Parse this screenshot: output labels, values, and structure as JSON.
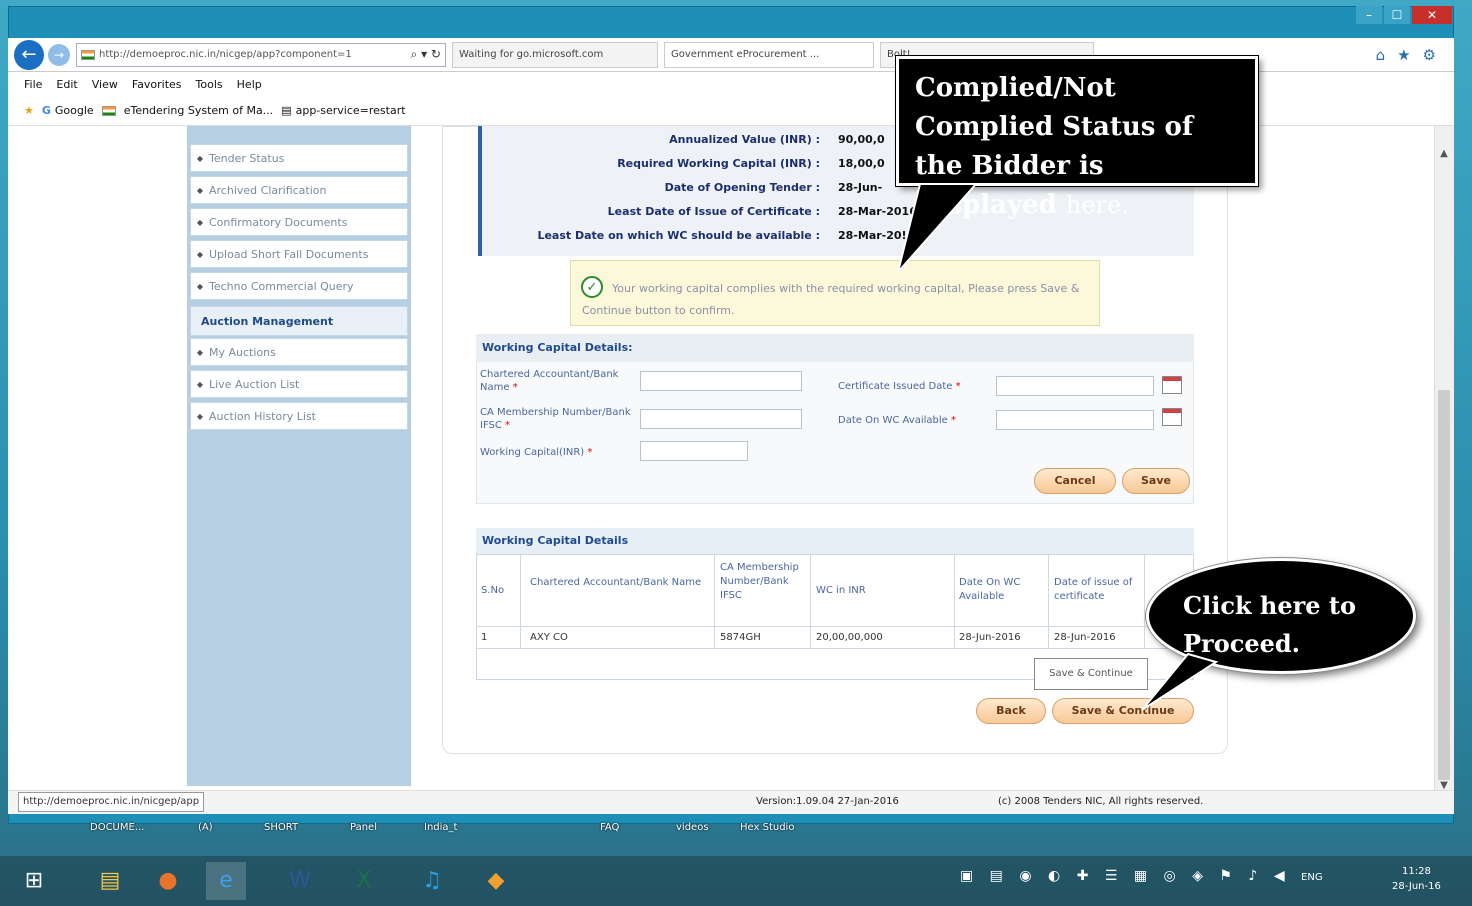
{
  "browser": {
    "address": "http://demoeproc.nic.in/nicgep/app?component=1",
    "tabs": [
      "Waiting for go.microsoft.com",
      "Government eProcurement ...",
      "Bolt!"
    ],
    "window_controls": [
      "–",
      "☐",
      "✕"
    ],
    "nav_icons": [
      "⌂",
      "★",
      "⚙"
    ]
  },
  "menu": [
    "File",
    "Edit",
    "View",
    "Favorites",
    "Tools",
    "Help"
  ],
  "favorites": [
    "Google",
    "eTendering System of Ma...",
    "app-service=restart"
  ],
  "sidebar": {
    "items_top": [
      "Tender Status",
      "Archived Clarification",
      "Confirmatory Documents",
      "Upload Short Fall Documents",
      "Techno Commercial Query"
    ],
    "section_heading": "Auction Management",
    "items_bottom": [
      "My Auctions",
      "Live Auction List",
      "Auction History List"
    ]
  },
  "info": {
    "rows": [
      {
        "label": "Annualized Value (INR) :",
        "value": "90,00,0"
      },
      {
        "label": "Required Working Capital (INR) :",
        "value": "18,00,0"
      },
      {
        "label": "Date of Opening Tender :",
        "value": "28-Jun-"
      },
      {
        "label": "Least Date of Issue of Certificate :",
        "value": "28-Mar-2016"
      },
      {
        "label": "Least Date on which WC should be available :",
        "value": "28-Mar-20!"
      }
    ]
  },
  "success_message": "Your working capital complies with the required working capital, Please press Save & Continue button to confirm.",
  "form": {
    "heading": "Working Capital Details:",
    "ca_name_label": "Chartered Accountant/Bank Name",
    "ca_membership_label": "CA Membership Number/Bank IFSC",
    "working_capital_label": "Working Capital(INR)",
    "cert_issued_label": "Certificate Issued Date",
    "date_wc_label": "Date On WC Available",
    "required_mark": "*",
    "cancel": "Cancel",
    "save": "Save"
  },
  "table": {
    "heading": "Working Capital Details",
    "columns": [
      "S.No",
      "Chartered Accountant/Bank Name",
      "CA Membership Number/Bank IFSC",
      "WC in INR",
      "Date On WC Available",
      "Date of issue of certificate"
    ],
    "rows": [
      [
        "1",
        "AXY CO",
        "5874GH",
        "20,00,00,000",
        "28-Jun-2016",
        "28-Jun-2016"
      ]
    ]
  },
  "tooltip": "Save & Continue",
  "buttons": {
    "back": "Back",
    "save_continue": "Save & Continue"
  },
  "footer": {
    "version": "Version:1.09.04 27-Jan-2016",
    "copyright": "(c) 2008 Tenders NIC, All rights reserved."
  },
  "status_url": "http://demoeproc.nic.in/nicgep/app",
  "callouts": {
    "top_bold": "Complied/Not Complied Status of the Bidder is Displayed",
    "top_normal": "here.",
    "bottom": "Click here to Proceed."
  },
  "desktop_labels": [
    "DOCUME...",
    "(A)",
    "SHORT",
    "Panel",
    "India_t",
    "FAQ",
    "videos",
    "Hex Studio"
  ],
  "clock": {
    "time": "11:28",
    "date": "28-Jun-16"
  },
  "tray_lang": "ENG"
}
